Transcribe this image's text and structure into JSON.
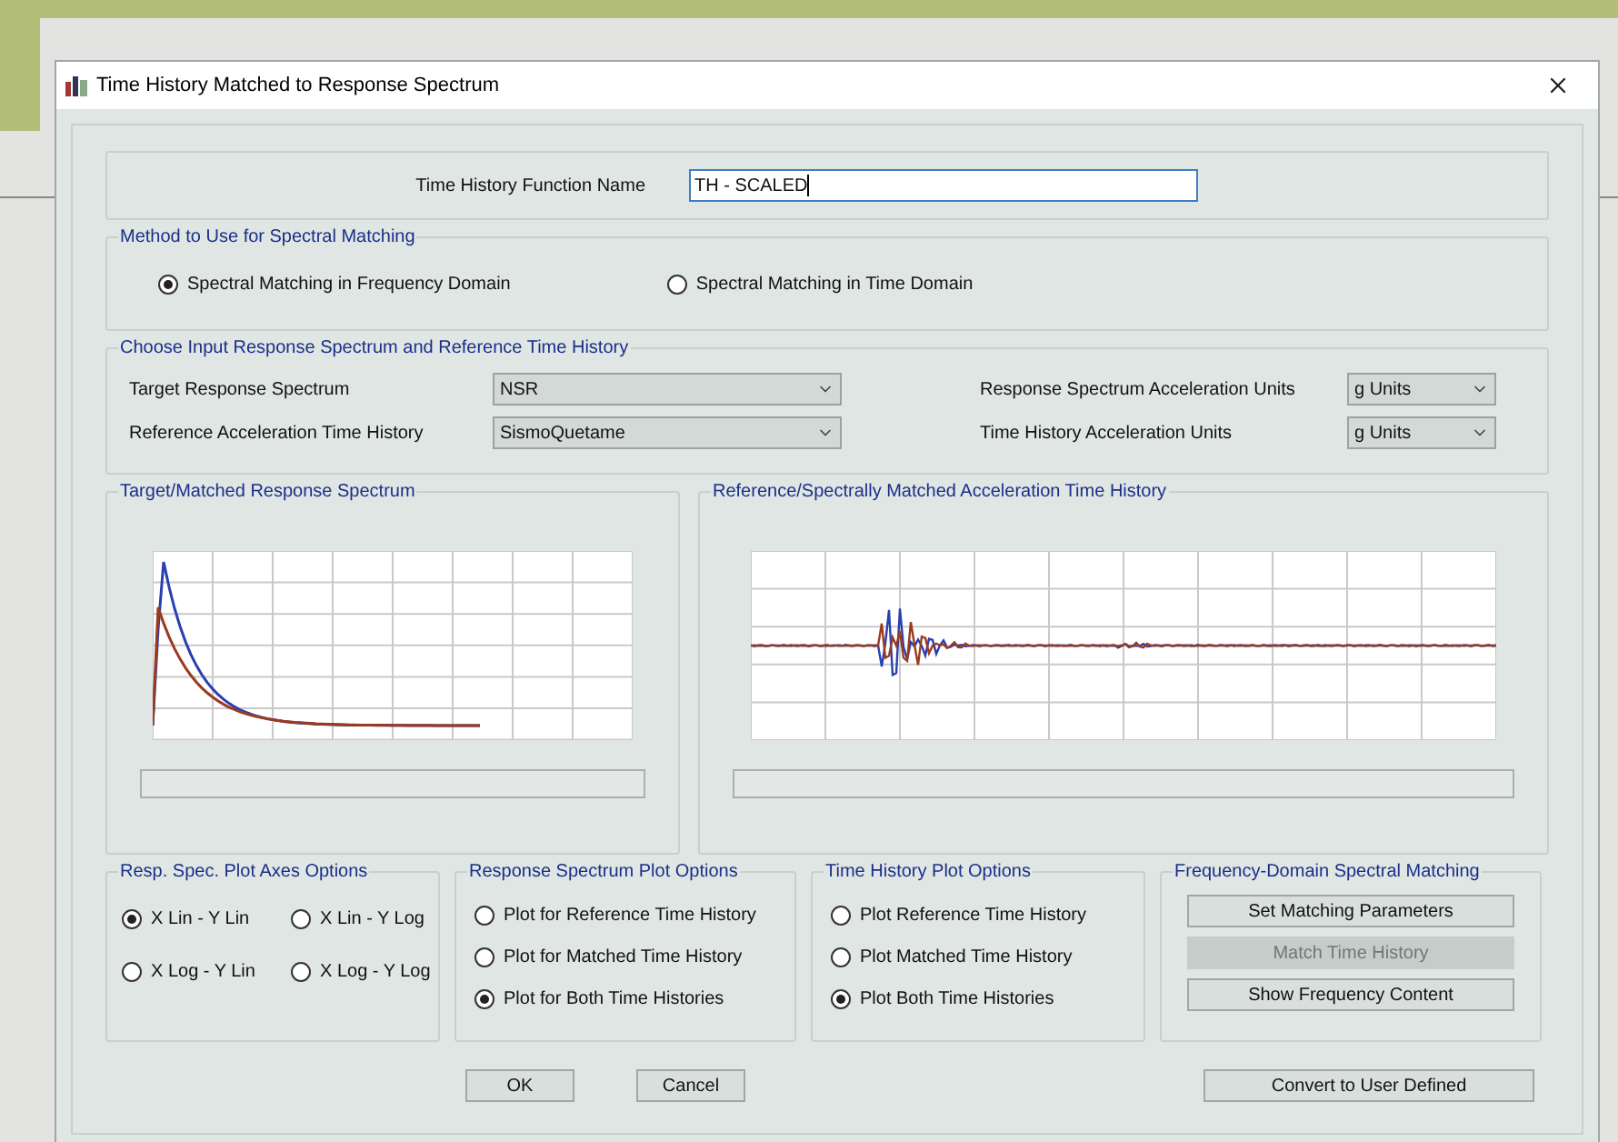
{
  "window": {
    "title": "Time History Matched to Response Spectrum"
  },
  "name_field": {
    "label": "Time History Function Name",
    "value": "TH - SCALED"
  },
  "method": {
    "title": "Method to Use for Spectral Matching",
    "options": [
      {
        "label": "Spectral Matching in Frequency Domain",
        "selected": true
      },
      {
        "label": "Spectral Matching in Time Domain",
        "selected": false
      }
    ]
  },
  "input": {
    "title": "Choose Input Response Spectrum and Reference Time History",
    "left_fields": [
      {
        "label": "Target Response Spectrum",
        "value": "NSR"
      },
      {
        "label": "Reference Acceleration Time History",
        "value": "SismoQuetame"
      }
    ],
    "right_fields": [
      {
        "label": "Response Spectrum Acceleration Units",
        "value": "g Units"
      },
      {
        "label": "Time History Acceleration Units",
        "value": "g Units"
      }
    ]
  },
  "plots": [
    {
      "title": "Target/Matched Response Spectrum",
      "kind": "spectrum"
    },
    {
      "title": "Reference/Spectrally Matched Acceleration Time History",
      "kind": "history"
    }
  ],
  "option_groups": [
    {
      "title": "Resp. Spec. Plot Axes Options",
      "kind": "grid",
      "options": [
        {
          "label": "X Lin - Y Lin",
          "selected": true
        },
        {
          "label": "X Lin - Y Log",
          "selected": false
        },
        {
          "label": "X Log - Y Lin",
          "selected": false
        },
        {
          "label": "X Log - Y Log",
          "selected": false
        }
      ]
    },
    {
      "title": "Response Spectrum Plot Options",
      "kind": "list",
      "options": [
        {
          "label": "Plot for Reference Time History",
          "selected": false
        },
        {
          "label": "Plot for Matched Time History",
          "selected": false
        },
        {
          "label": "Plot for Both Time Histories",
          "selected": true
        }
      ]
    },
    {
      "title": "Time History Plot Options",
      "kind": "list",
      "options": [
        {
          "label": "Plot Reference Time History",
          "selected": false
        },
        {
          "label": "Plot Matched Time History",
          "selected": false
        },
        {
          "label": "Plot Both Time Histories",
          "selected": true
        }
      ]
    },
    {
      "title": "Frequency-Domain Spectral Matching",
      "kind": "buttons",
      "buttons": [
        {
          "label": "Set Matching Parameters",
          "disabled": false
        },
        {
          "label": "Match Time History",
          "disabled": true
        },
        {
          "label": "Show Frequency Content",
          "disabled": false
        }
      ]
    }
  ],
  "footer_buttons": [
    "OK",
    "Cancel"
  ],
  "convert_button": "Convert to User Defined"
}
